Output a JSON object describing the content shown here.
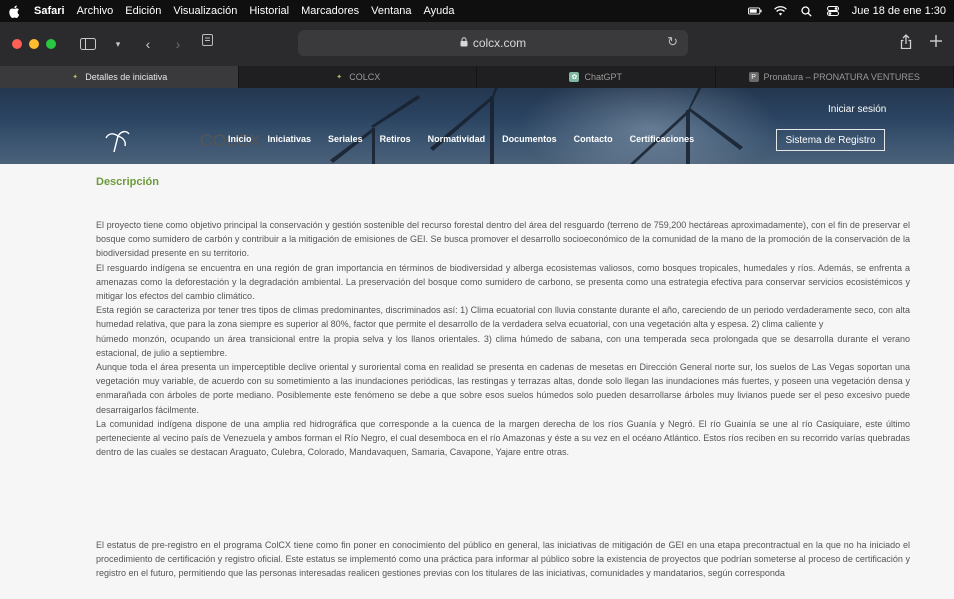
{
  "menubar": {
    "app": "Safari",
    "items": [
      "Archivo",
      "Edición",
      "Visualización",
      "Historial",
      "Marcadores",
      "Ventana",
      "Ayuda"
    ],
    "clock": "Jue 18 de ene 1:30"
  },
  "toolbar": {
    "address": "colcx.com"
  },
  "tabs": [
    {
      "label": "Detalles de iniciativa",
      "icon": "leaf-icon"
    },
    {
      "label": "COLCX",
      "icon": "leaf-icon"
    },
    {
      "label": "ChatGPT",
      "icon": "chatgpt-icon"
    },
    {
      "label": "Pronatura – PRONATURA VENTURES",
      "icon": "pronatura-icon"
    }
  ],
  "site": {
    "logo": "COLCX",
    "nav": [
      "Inicio",
      "Iniciativas",
      "Seriales",
      "Retiros",
      "Normatividad",
      "Documentos",
      "Contacto",
      "Certificaciones"
    ],
    "login": "Iniciar sesión",
    "registro": "Sistema de Registro"
  },
  "content": {
    "title": "Descripción",
    "paragraph1": "El proyecto tiene como objetivo principal la conservación y gestión sostenible del recurso forestal dentro del área del resguardo (terreno de 759,200 hectáreas aproximadamente), con el fin de preservar el bosque como sumidero de carbón y contribuir a la mitigación de emisiones de GEI. Se busca promover el desarrollo socioeconómico de la comunidad de la mano de la promoción de la conservación de la biodiversidad presente en su territorio.\nEl resguardo indígena se encuentra en una región de gran importancia en términos de biodiversidad y alberga ecosistemas valiosos, como bosques tropicales, humedales y ríos. Además, se enfrenta a amenazas como la deforestación y la degradación ambiental. La preservación del bosque como sumidero de carbono, se presenta como una estrategia efectiva para conservar servicios ecosistémicos y mitigar los efectos del cambio climático.\nEsta región se caracteriza por tener tres tipos de climas predominantes, discriminados así: 1) Clima ecuatorial con lluvia constante durante el año, careciendo de un periodo verdaderamente seco, con alta humedad relativa, que para la zona siempre es superior al 80%, factor que permite el desarrollo de la verdadera selva ecuatorial, con una vegetación alta y espesa. 2) clima caliente y\nhúmedo monzón, ocupando un área transicional entre la propia selva y los llanos orientales. 3) clima húmedo de sabana, con una temperada seca prolongada que se desarrolla durante el verano estacional, de julio a septiembre.\nAunque toda el área presenta un imperceptible declive oriental y suroriental coma en realidad se presenta en cadenas de mesetas en Dirección General norte sur, los suelos de Las Vegas soportan una vegetación muy variable, de acuerdo con su sometimiento a las inundaciones periódicas, las restingas y terrazas altas, donde solo llegan las inundaciones más fuertes, y poseen una vegetación densa y enmarañada con árboles de porte mediano. Posiblemente este fenómeno se debe a que sobre esos suelos húmedos solo pueden desarrollarse árboles muy livianos puede ser el peso excesivo puede desarraigarlos fácilmente.\nLa comunidad indígena dispone de una amplia red hidrográfica que corresponde a la cuenca de la margen derecha de los ríos Guanía y Negró. El río Guainía se une al río Casiquiare, este último perteneciente al vecino país de Venezuela y ambos forman el Río Negro, el cual desemboca en el río Amazonas y éste a su vez en el océano Atlántico. Estos ríos reciben en su recorrido varías quebradas dentro de las cuales se destacan Araguato, Culebra, Colorado, Mandavaquen, Samaria, Cavapone, Yajare entre otras.",
    "paragraph2": "El estatus de pre-registro en el programa ColCX tiene como fin poner en conocimiento del público en general, las iniciativas de mitigación de GEI en una etapa precontractual en la que no ha iniciado el procedimiento de certificación y registro oficial. Este estatus se implementó como una práctica para informar al público sobre la existencia de proyectos que podrían someterse al proceso de certificación y registro en el futuro, permitiendo que las personas interesadas realicen gestiones previas con los titulares de las iniciativas, comunidades y mandatarios, según corresponda"
  }
}
